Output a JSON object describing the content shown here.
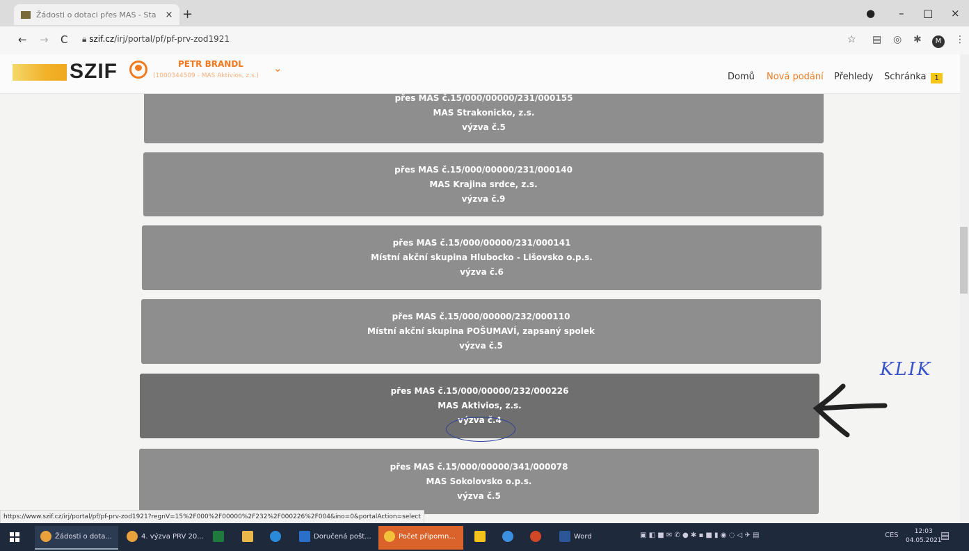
{
  "browser": {
    "tab_title": "Žádosti o dotaci přes MAS - Sta",
    "new_tab": "+",
    "tab_close": "×",
    "url_domain": "szif.cz",
    "url_path": "/irj/portal/pf/pf-prv-zod1921",
    "status_url": "https://www.szif.cz/irj/portal/pf/pf-prv-zod1921?regnV=15%2F000%2F00000%2F232%2F000226%2F004&ino=0&portalAction=select"
  },
  "header": {
    "logo": "SZIF",
    "user_name": "PETR BRANDL",
    "user_sub": "(1000344509 - MAS Aktivios, z.s.)",
    "nav": [
      "Domů",
      "Nová podání",
      "Přehledy",
      "Schránka"
    ],
    "inbox_count": "1"
  },
  "cards": [
    {
      "line1": "přes MAS č.15/000/00000/231/000155",
      "line2": "MAS Strakonicko, z.s.",
      "line3": "výzva č.5"
    },
    {
      "line1": "přes MAS č.15/000/00000/231/000140",
      "line2": "MAS Krajina srdce, z.s.",
      "line3": "výzva č.9"
    },
    {
      "line1": "přes MAS č.15/000/00000/231/000141",
      "line2": "Místní akční skupina Hlubocko - Lišovsko o.p.s.",
      "line3": "výzva č.6"
    },
    {
      "line1": "přes MAS č.15/000/00000/232/000110",
      "line2": "Místní akční skupina POŠUMAVÍ, zapsaný spolek",
      "line3": "výzva č.5"
    },
    {
      "line1": "přes MAS č.15/000/00000/232/000226",
      "line2": "MAS Aktivios, z.s.",
      "line3": "výzva č.4"
    },
    {
      "line1": "přes MAS č.15/000/00000/341/000078",
      "line2": "MAS Sokolovsko o.p.s.",
      "line3": "výzva č.5"
    }
  ],
  "annotation": {
    "text": "KLIK"
  },
  "taskbar": {
    "items": [
      "Žádosti o dota...",
      "4. výzva PRV 20...",
      "Doručená pošt...",
      "Počet připomn...",
      "Word"
    ],
    "time": "12:03",
    "date": "04.05.2021",
    "lang": "CES"
  },
  "colors": {
    "accent": "#f07a20",
    "card": "#8e8e8e",
    "card_selected": "#6f6f6f",
    "annotation": "#3a54c8"
  }
}
